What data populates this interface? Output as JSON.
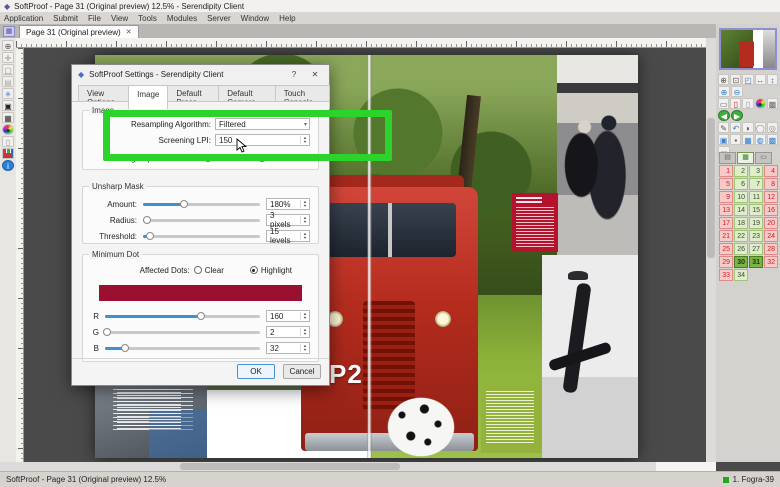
{
  "window": {
    "icon": "◆",
    "title": "SoftProof - Page 31 (Original preview) 12.5% - Serendipity Client"
  },
  "menu": {
    "items": [
      "Application",
      "Submit",
      "File",
      "View",
      "Tools",
      "Modules",
      "Server",
      "Window",
      "Help"
    ]
  },
  "tabbar": {
    "label": "Page 31 (Original preview)",
    "close": "✕"
  },
  "dialog": {
    "icon": "◆",
    "title": "SoftProof Settings - Serendipity Client",
    "help": "?",
    "close": "✕",
    "tabs": [
      {
        "label": "View Options",
        "active": false
      },
      {
        "label": "Image",
        "active": true
      },
      {
        "label": "Default Press",
        "active": false
      },
      {
        "label": "Default Camera",
        "active": false
      },
      {
        "label": "Touch Console",
        "active": false
      }
    ],
    "image_group": {
      "label": "Image",
      "resampling": {
        "label": "Resampling Algorithm:",
        "value": "Filtered"
      },
      "screening": {
        "label": "Screening LPI:",
        "value": "150"
      },
      "merge": {
        "label": "Merge Spot Colours In:",
        "options": [
          {
            "label": "RGB",
            "selected": false
          },
          {
            "label": "CMYK",
            "selected": true
          }
        ]
      }
    },
    "unsharp_group": {
      "label": "Unsharp Mask",
      "rows": [
        {
          "name": "amount",
          "label": "Amount:",
          "value": "180%",
          "pos": 35
        },
        {
          "name": "radius",
          "label": "Radius:",
          "value": "3 pixels",
          "pos": 3
        },
        {
          "name": "threshold",
          "label": "Threshold:",
          "value": "15 levels",
          "pos": 6
        }
      ]
    },
    "mindot_group": {
      "label": "Minimum Dot",
      "affected": {
        "label": "Affected Dots:",
        "options": [
          {
            "label": "Clear",
            "selected": false
          },
          {
            "label": "Highlight",
            "selected": true
          }
        ]
      },
      "swatch_color": "#9b0f30",
      "channels": [
        {
          "label": "R",
          "value": "160",
          "pos": 62
        },
        {
          "label": "G",
          "value": "2",
          "pos": 1
        },
        {
          "label": "B",
          "value": "32",
          "pos": 13
        }
      ]
    },
    "ok": "OK",
    "cancel": "Cancel"
  },
  "annotation": {
    "color": "#2bd32b"
  },
  "canvas": {
    "truck_label": "P2"
  },
  "left_tools": [
    {
      "name": "zoom-tool-icon",
      "glyph": "⊕",
      "color": "#555"
    },
    {
      "name": "pan-tool-icon",
      "glyph": "✛",
      "color": "#888"
    },
    {
      "name": "page-frame-icon",
      "glyph": "▢",
      "color": "#888"
    },
    {
      "name": "guides-icon",
      "glyph": "▤",
      "color": "#aaa"
    },
    {
      "name": "snowflake-icon",
      "glyph": "✳",
      "color": "#2e7fd6"
    },
    {
      "name": "camera-icon",
      "glyph": "▣",
      "color": "#222"
    },
    {
      "name": "checker-grid-icon",
      "glyph": "▦",
      "color": "#333"
    },
    {
      "name": "color-wheel-icon",
      "glyph": "●",
      "color": "#333",
      "cls": "wheel"
    },
    {
      "name": "document-icon",
      "glyph": "▯",
      "color": "#999"
    },
    {
      "name": "histogram-icon",
      "glyph": "▅",
      "color": "#c0392b",
      "cls": "bars"
    },
    {
      "name": "info-icon",
      "glyph": "i",
      "color": "#fff",
      "cls": "blue-badge"
    }
  ],
  "sidebar": {
    "tool_rows": [
      [
        {
          "name": "zoom-area-icon",
          "glyph": "⊕",
          "color": "#555"
        },
        {
          "name": "zoom-page-icon",
          "glyph": "⊡",
          "color": "#555"
        },
        {
          "name": "fit-window-icon",
          "glyph": "◰",
          "color": "#3a6fae"
        },
        {
          "name": "fit-width-icon",
          "glyph": "↔",
          "color": "#3a6fae"
        },
        {
          "name": "fit-height-icon",
          "glyph": "↕",
          "color": "#3a6fae"
        }
      ],
      [
        {
          "name": "zoom-in-icon",
          "glyph": "⊕",
          "color": "#2e7fd6"
        },
        {
          "name": "zoom-out-icon",
          "glyph": "⊖",
          "color": "#2e7fd6"
        }
      ],
      [
        {
          "name": "monitor-icon",
          "glyph": "▭",
          "color": "#556"
        },
        {
          "name": "alert-page-icon",
          "glyph": "▯",
          "color": "#c22"
        },
        {
          "name": "blank-page-icon",
          "glyph": "▯",
          "color": "#999"
        },
        {
          "name": "colour-wheel-icon",
          "glyph": "●",
          "color": "#333",
          "cls": "wheel"
        },
        {
          "name": "dither-icon",
          "glyph": "▩",
          "color": "#666"
        }
      ],
      [
        {
          "name": "prev-page-icon",
          "glyph": "◀",
          "color": "#fff",
          "cls": "green-badge"
        },
        {
          "name": "next-page-icon",
          "glyph": "▶",
          "color": "#fff",
          "cls": "green-badge"
        }
      ],
      [
        {
          "name": "edit-pencil-icon",
          "glyph": "✎",
          "color": "#555"
        },
        {
          "name": "undo-icon",
          "glyph": "↶",
          "color": "#2e7fd6"
        },
        {
          "name": "eyedropper-icon",
          "glyph": "◗",
          "color": "#446"
        },
        {
          "name": "circle-select-icon",
          "glyph": "◯",
          "color": "#888"
        },
        {
          "name": "target-icon",
          "glyph": "◎",
          "color": "#888"
        }
      ],
      [
        {
          "name": "snap-icon",
          "glyph": "▣",
          "color": "#2e7fd6"
        },
        {
          "name": "lock-icon",
          "glyph": "▪",
          "color": "#555"
        },
        {
          "name": "grid-icon",
          "glyph": "▦",
          "color": "#2e7fd6"
        },
        {
          "name": "globe-icon",
          "glyph": "◍",
          "color": "#2e7fd6"
        },
        {
          "name": "hash-grid-icon",
          "glyph": "▩",
          "color": "#2e7fd6"
        }
      ],
      [
        {
          "name": "shortcut-icon",
          "glyph": "▭",
          "color": "#888"
        }
      ]
    ],
    "grid_tabs": [
      {
        "name": "pages-tab-layout",
        "glyph": "▤",
        "active": false
      },
      {
        "name": "pages-tab-pages",
        "glyph": "▦",
        "active": true
      },
      {
        "name": "pages-tab-other",
        "glyph": "▭",
        "active": false
      }
    ],
    "pages": [
      {
        "n": "1",
        "s": "pink"
      },
      {
        "n": "2",
        "s": "green"
      },
      {
        "n": "3",
        "s": "green"
      },
      {
        "n": "4",
        "s": "pink"
      },
      {
        "n": "5",
        "s": "pink"
      },
      {
        "n": "6",
        "s": "green"
      },
      {
        "n": "7",
        "s": "green"
      },
      {
        "n": "8",
        "s": "pink"
      },
      {
        "n": "9",
        "s": "pink"
      },
      {
        "n": "10",
        "s": "green"
      },
      {
        "n": "11",
        "s": "green"
      },
      {
        "n": "12",
        "s": "pink"
      },
      {
        "n": "13",
        "s": "pink"
      },
      {
        "n": "14",
        "s": "green"
      },
      {
        "n": "15",
        "s": "green"
      },
      {
        "n": "16",
        "s": "pink"
      },
      {
        "n": "17",
        "s": "pink"
      },
      {
        "n": "18",
        "s": "green"
      },
      {
        "n": "19",
        "s": "green"
      },
      {
        "n": "20",
        "s": "pink"
      },
      {
        "n": "21",
        "s": "pink"
      },
      {
        "n": "22",
        "s": "green"
      },
      {
        "n": "23",
        "s": "green"
      },
      {
        "n": "24",
        "s": "pink"
      },
      {
        "n": "25",
        "s": "pink"
      },
      {
        "n": "26",
        "s": "green"
      },
      {
        "n": "27",
        "s": "green"
      },
      {
        "n": "28",
        "s": "pink"
      },
      {
        "n": "29",
        "s": "pink"
      },
      {
        "n": "30",
        "s": "sel"
      },
      {
        "n": "31",
        "s": "sel"
      },
      {
        "n": "32",
        "s": "pink"
      },
      {
        "n": "33",
        "s": "pink"
      },
      {
        "n": "34",
        "s": "green"
      }
    ]
  },
  "statusbar": {
    "left": "SoftProof - Page 31 (Original preview) 12.5%",
    "printer": "1. Fogra-39"
  }
}
